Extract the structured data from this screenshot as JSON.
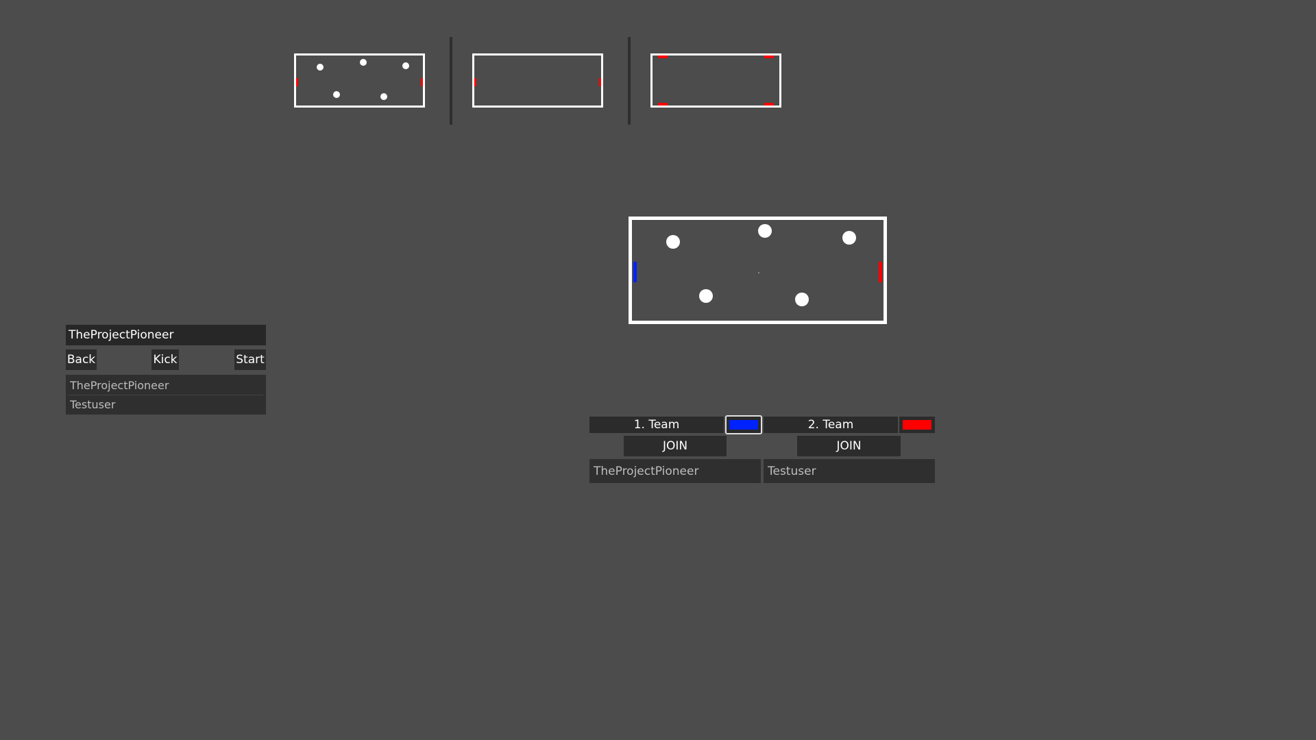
{
  "colors": {
    "background": "#4c4c4c",
    "team1": "#0022ff",
    "team2": "#ff0000",
    "goal_preview": "#ff0000"
  },
  "map_previews": [
    {
      "name": "map-preview-1",
      "balls": 5,
      "goals": "side"
    },
    {
      "name": "map-preview-2",
      "balls": 0,
      "goals": "side"
    },
    {
      "name": "map-preview-3",
      "balls": 0,
      "goals": "corner"
    }
  ],
  "lobby": {
    "host_name": "TheProjectPioneer",
    "back_label": "Back",
    "kick_label": "Kick",
    "start_label": "Start",
    "users": [
      "TheProjectPioneer",
      "Testuser"
    ]
  },
  "teams": [
    {
      "label": "1. Team",
      "join_label": "JOIN",
      "color": "#0022ff",
      "members": "TheProjectPioneer"
    },
    {
      "label": "2. Team",
      "join_label": "JOIN",
      "color": "#ff0000",
      "members": "Testuser"
    }
  ]
}
